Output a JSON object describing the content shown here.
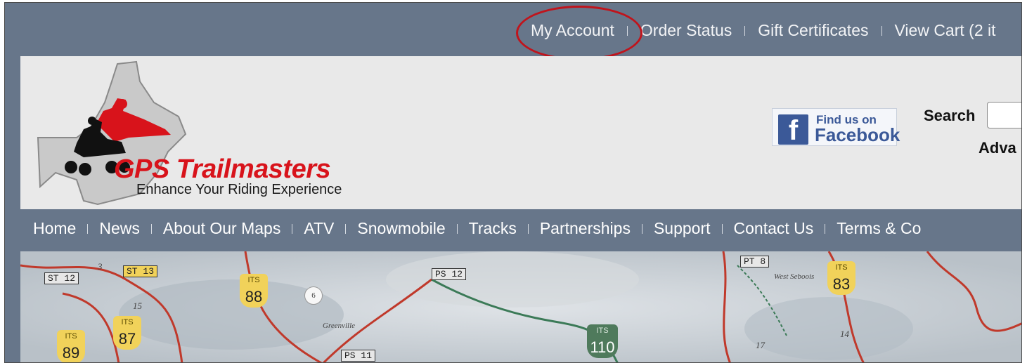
{
  "top_links": [
    "My Account",
    "Order Status",
    "Gift Certificates",
    "View Cart (2 it"
  ],
  "brand": {
    "name": "GPS Trailmasters",
    "tagline": "Enhance Your Riding Experience"
  },
  "facebook": {
    "small": "Find us on",
    "big": "Facebook",
    "icon": "f"
  },
  "search": {
    "label": "Search",
    "placeholder": "",
    "advanced": "Adva"
  },
  "nav_links": [
    "Home",
    "News",
    "About Our Maps",
    "ATV",
    "Snowmobile",
    "Tracks",
    "Partnerships",
    "Support",
    "Contact Us",
    "Terms & Co"
  ],
  "map": {
    "shields": [
      {
        "its": "ITS",
        "num": "88"
      },
      {
        "its": "ITS",
        "num": "87"
      },
      {
        "its": "ITS",
        "num": "89"
      },
      {
        "its": "ITS",
        "num": "83"
      },
      {
        "its": "ITS",
        "num": "110"
      }
    ],
    "tags": [
      "ST 12",
      "ST 13",
      "PS 12",
      "PT 8",
      "PS 11"
    ],
    "places": [
      "West Seboois",
      "Greenville",
      "6",
      "3",
      "15",
      "14",
      "17"
    ]
  },
  "colors": {
    "bar": "#67768a",
    "header_bg": "#e9e9e9",
    "brand_red": "#d8131b",
    "highlight_ring": "#c0141c",
    "facebook_blue": "#3b5998"
  }
}
